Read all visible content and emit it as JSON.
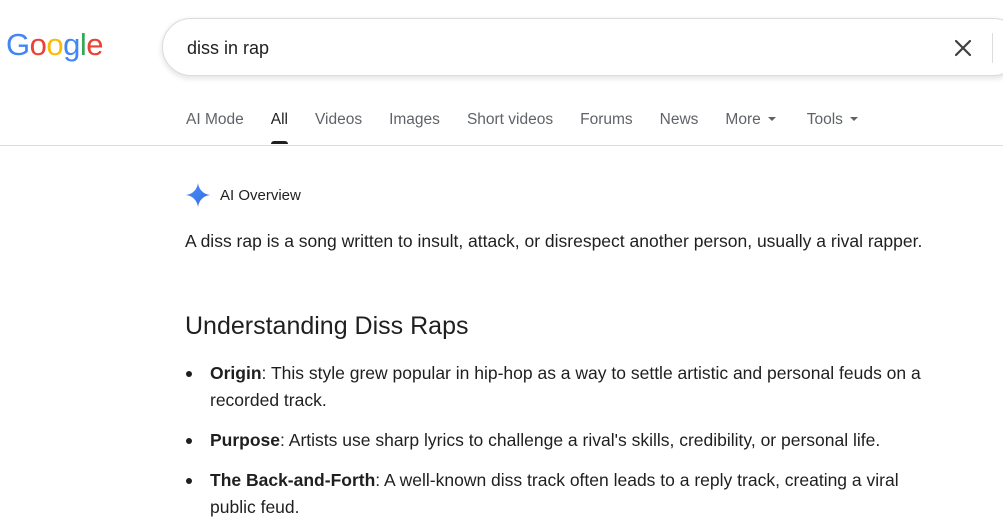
{
  "logo": {
    "letters": [
      {
        "char": "G",
        "color": "#4285F4"
      },
      {
        "char": "o",
        "color": "#EA4335"
      },
      {
        "char": "o",
        "color": "#FBBC05"
      },
      {
        "char": "g",
        "color": "#4285F4"
      },
      {
        "char": "l",
        "color": "#34A853"
      },
      {
        "char": "e",
        "color": "#EA4335"
      }
    ]
  },
  "search": {
    "query": "diss in rap",
    "clear_icon": "close-icon"
  },
  "tabs": [
    {
      "label": "AI Mode",
      "active": false
    },
    {
      "label": "All",
      "active": true
    },
    {
      "label": "Videos",
      "active": false
    },
    {
      "label": "Images",
      "active": false
    },
    {
      "label": "Short videos",
      "active": false
    },
    {
      "label": "Forums",
      "active": false
    },
    {
      "label": "News",
      "active": false
    },
    {
      "label": "More",
      "active": false,
      "has_caret": true
    },
    {
      "label": "Tools",
      "active": false,
      "has_caret": true
    }
  ],
  "ai_overview": {
    "title": "AI Overview",
    "icon": "gemini-sparkle-icon",
    "summary": "A diss rap is a song written to insult, attack, or disrespect another person, usually a rival rapper.",
    "heading": "Understanding Diss Raps",
    "points": [
      {
        "term": "Origin",
        "text": ": This style grew popular in hip-hop as a way to settle artistic and personal feuds on a recorded track."
      },
      {
        "term": "Purpose",
        "text": ": Artists use sharp lyrics to challenge a rival's skills, credibility, or personal life."
      },
      {
        "term": "The Back-and-Forth",
        "text": ": A well-known diss track often leads to a reply track, creating a viral public feud."
      }
    ]
  },
  "colors": {
    "text_primary": "#1f1f1f",
    "text_secondary": "#5f6368",
    "divider": "#dadce0",
    "sparkle": "#4285F4"
  }
}
